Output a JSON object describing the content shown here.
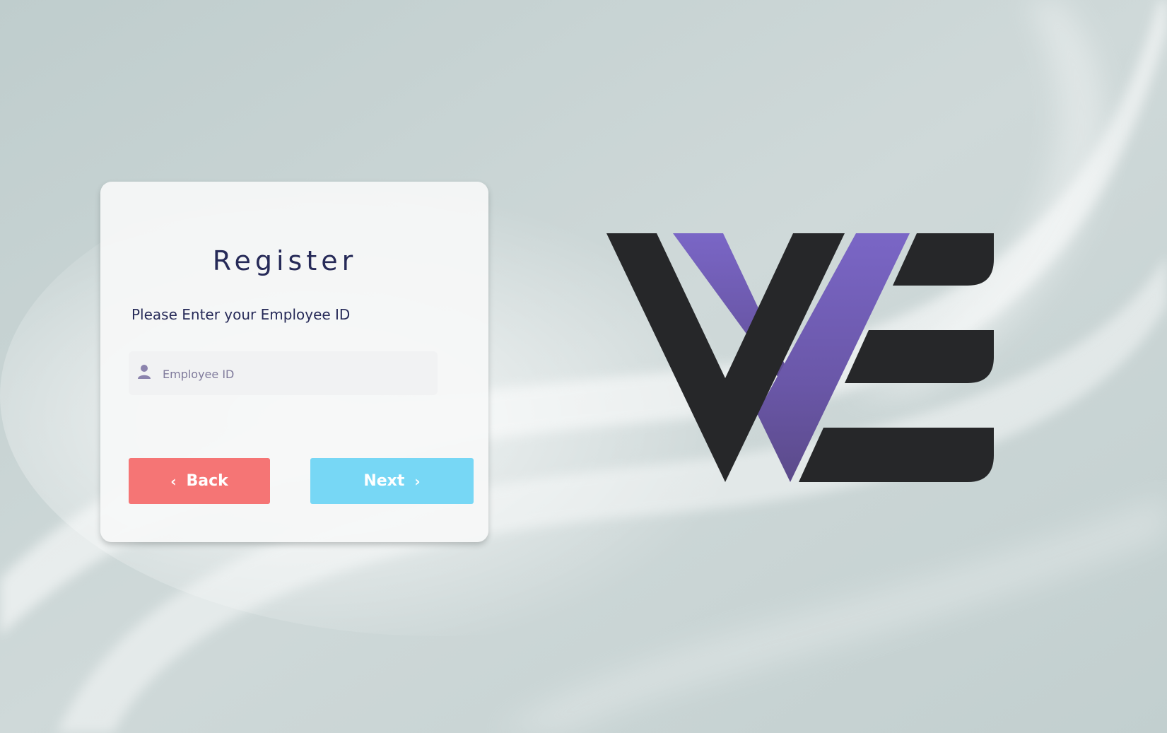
{
  "register": {
    "title": "Register",
    "subtitle": "Please Enter your Employee ID",
    "employee_id_placeholder": "Employee ID",
    "employee_id_value": "",
    "back_label": "Back",
    "next_label": "Next"
  },
  "icons": {
    "input": "user-icon",
    "back": "chevron-left-icon",
    "next": "chevron-right-icon"
  },
  "colors": {
    "title_text": "#262a58",
    "back_button": "#f57575",
    "next_button": "#77d7f5",
    "logo_dark": "#262729",
    "logo_purple": "#7261bb"
  }
}
